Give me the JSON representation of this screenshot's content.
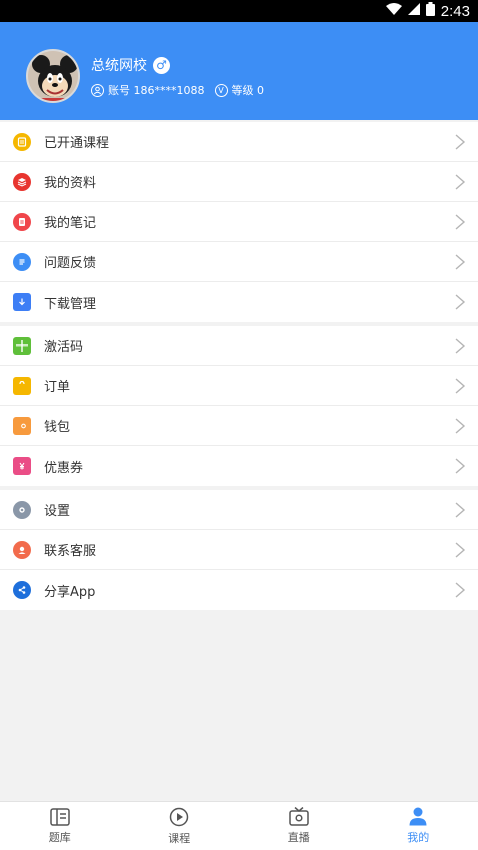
{
  "status_bar": {
    "time": "2:43"
  },
  "profile": {
    "name": "总统网校",
    "gender_symbol": "♂",
    "account_text": "账号 186****1088",
    "level_text": "等级 0"
  },
  "menu": {
    "group1": [
      {
        "label": "已开通课程",
        "icon": "course-icon",
        "color": "#f5b700"
      },
      {
        "label": "我的资料",
        "icon": "materials-icon",
        "color": "#e8352f"
      },
      {
        "label": "我的笔记",
        "icon": "notes-icon",
        "color": "#f0464b"
      },
      {
        "label": "问题反馈",
        "icon": "feedback-icon",
        "color": "#3d8ef5"
      },
      {
        "label": "下载管理",
        "icon": "download-icon",
        "color": "#3d7ef5"
      }
    ],
    "group2": [
      {
        "label": "激活码",
        "icon": "gift-icon",
        "color": "#5fbf3a"
      },
      {
        "label": "订单",
        "icon": "shopping-bag-icon",
        "color": "#f5b700"
      },
      {
        "label": "钱包",
        "icon": "wallet-icon",
        "color": "#f79a3d"
      },
      {
        "label": "优惠券",
        "icon": "coupon-icon",
        "color": "#ea4d86"
      }
    ],
    "group3": [
      {
        "label": "设置",
        "icon": "gear-icon",
        "color": "#8a97a8"
      },
      {
        "label": "联系客服",
        "icon": "customer-service-icon",
        "color": "#f26b4c"
      },
      {
        "label": "分享App",
        "icon": "share-icon",
        "color": "#1e6fdb"
      }
    ]
  },
  "bottom_nav": {
    "tabs": [
      {
        "label": "题库",
        "icon": "question-bank-icon"
      },
      {
        "label": "课程",
        "icon": "play-circle-icon"
      },
      {
        "label": "直播",
        "icon": "tv-icon"
      },
      {
        "label": "我的",
        "icon": "person-icon",
        "active": true
      }
    ],
    "accent": "#3d8ef5"
  }
}
